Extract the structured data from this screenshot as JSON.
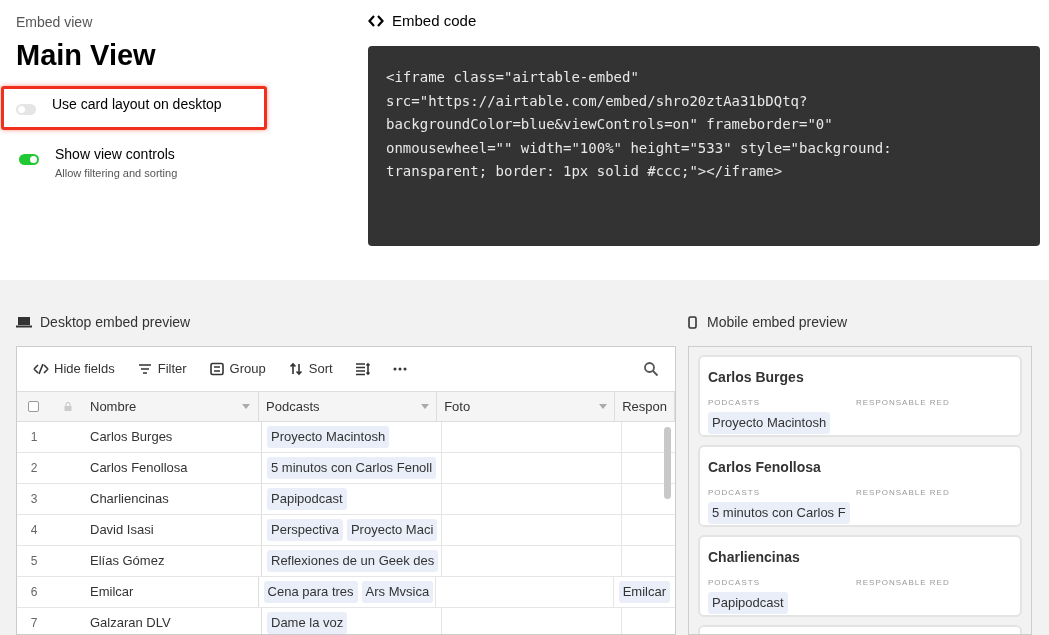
{
  "header": {
    "eyebrow": "Embed view",
    "title": "Main View"
  },
  "options": [
    {
      "label": "Use card layout on desktop",
      "on": false,
      "highlighted": true
    },
    {
      "label": "Show view controls",
      "description": "Allow filtering and sorting",
      "on": true,
      "highlighted": false
    }
  ],
  "embed_code": {
    "title": "Embed code",
    "lines": [
      "<iframe class=\"airtable-embed\"",
      "src=\"https://airtable.com/embed/shro20ztAa31bDQtq?",
      "backgroundColor=blue&viewControls=on\" frameborder=\"0\"",
      "onmousewheel=\"\" width=\"100%\" height=\"533\" style=\"background:",
      "transparent; border: 1px solid #ccc;\"></iframe>"
    ]
  },
  "desktop_preview": {
    "title": "Desktop embed preview",
    "toolbar": [
      {
        "kind": "hide",
        "label": "Hide fields"
      },
      {
        "kind": "filter",
        "label": "Filter"
      },
      {
        "kind": "group",
        "label": "Group"
      },
      {
        "kind": "sort",
        "label": "Sort"
      },
      {
        "kind": "height"
      },
      {
        "kind": "more"
      }
    ],
    "select_all_checked": false,
    "columns": [
      "Nombre",
      "Podcasts",
      "Foto",
      "Respon"
    ],
    "rows": [
      {
        "number": "1",
        "name": "Carlos Burges",
        "podcasts": [
          "Proyecto Macintosh"
        ]
      },
      {
        "number": "2",
        "name": "Carlos Fenollosa",
        "podcasts": [
          "5 minutos con Carlos Fenoll"
        ]
      },
      {
        "number": "3",
        "name": "Charliencinas",
        "podcasts": [
          "Papipodcast"
        ]
      },
      {
        "number": "4",
        "name": "David Isasi",
        "podcasts": [
          "Perspectiva",
          "Proyecto Maci"
        ]
      },
      {
        "number": "5",
        "name": "Elías Gómez",
        "podcasts": [
          "Reflexiones de un Geek des"
        ]
      },
      {
        "number": "6",
        "name": "Emilcar",
        "podcasts": [
          "Cena para tres",
          "Ars Mvsica"
        ],
        "column_4": [
          "Emilcar"
        ]
      },
      {
        "number": "7",
        "name": "Galzaran DLV",
        "podcasts": [
          "Dame la voz"
        ]
      }
    ]
  },
  "mobile_preview": {
    "title": "Mobile embed preview",
    "cards": [
      {
        "name": "Carlos Burges",
        "field_labels": [
          "PODCASTS",
          "RESPONSABLE RED"
        ],
        "podcasts": [
          "Proyecto Macintosh"
        ]
      },
      {
        "name": "Carlos Fenollosa",
        "field_labels": [
          "PODCASTS",
          "RESPONSABLE RED"
        ],
        "podcasts": [
          "5 minutos con Carlos F"
        ]
      },
      {
        "name": "Charliencinas",
        "field_labels": [
          "PODCASTS",
          "RESPONSABLE RED"
        ],
        "podcasts": [
          "Papipodcast"
        ]
      }
    ]
  }
}
